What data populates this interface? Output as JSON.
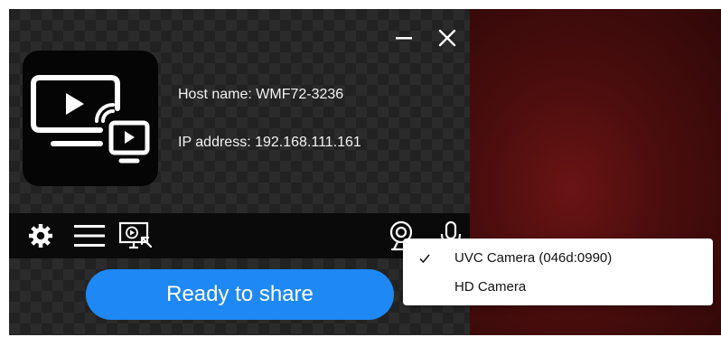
{
  "window": {
    "minimize_icon": "minimize-icon",
    "close_icon": "close-icon"
  },
  "app": {
    "logo_icon": "screen-mirroring-icon",
    "host_name": "Host name: WMF72-3236",
    "ip_address": "IP address: 192.168.111.161"
  },
  "toolbar": {
    "items": [
      {
        "icon": "gear-icon"
      },
      {
        "icon": "hamburger-menu-icon"
      },
      {
        "icon": "cast-screen-icon"
      },
      {
        "icon": "webcam-icon"
      },
      {
        "icon": "microphone-icon"
      }
    ]
  },
  "share_button": {
    "label": "Ready to share"
  },
  "camera_menu": {
    "items": [
      {
        "label": "UVC Camera (046d:0990)",
        "checked": true
      },
      {
        "label": "HD Camera",
        "checked": false
      }
    ]
  },
  "colors": {
    "accent": "#1e88f5",
    "app_background": "#222222",
    "toolbar_background": "#0a0a0a",
    "desktop_background": "#4a0d0d"
  }
}
